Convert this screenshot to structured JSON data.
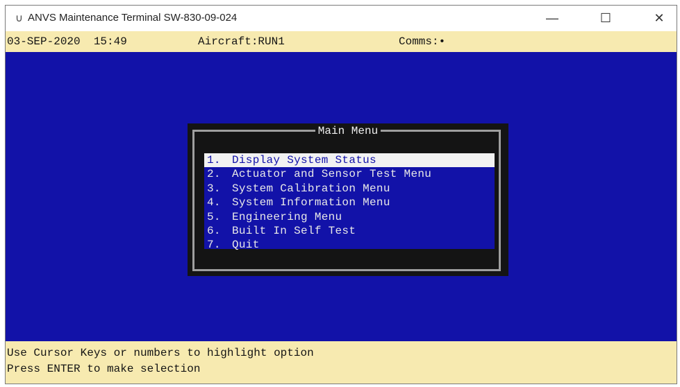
{
  "window": {
    "icon": "app-glyph-icon",
    "title": "ANVS Maintenance Terminal SW-830-09-024",
    "controls": {
      "minimize": "—",
      "maximize": "☐",
      "close": "✕"
    }
  },
  "status": {
    "date_time": "03-SEP-2020  15:49",
    "aircraft": "Aircraft:RUN1",
    "comms": "Comms:•"
  },
  "menu": {
    "title": "Main Menu",
    "selected_index": 0,
    "items": [
      {
        "number": "1.",
        "label": "Display System Status"
      },
      {
        "number": "2.",
        "label": "Actuator and Sensor Test Menu"
      },
      {
        "number": "3.",
        "label": "System Calibration Menu"
      },
      {
        "number": "4.",
        "label": "System Information Menu"
      },
      {
        "number": "5.",
        "label": "Engineering Menu"
      },
      {
        "number": "6.",
        "label": "Built In Self Test"
      },
      {
        "number": "7.",
        "label": "Quit"
      }
    ]
  },
  "help": {
    "line1": "Use Cursor Keys or numbers to highlight option",
    "line2": "Press ENTER to make selection"
  },
  "colors": {
    "terminal_blue": "#1212a8",
    "status_yellow": "#f7eab0",
    "menu_box": "#141414",
    "highlight": "#f2f2f2"
  }
}
